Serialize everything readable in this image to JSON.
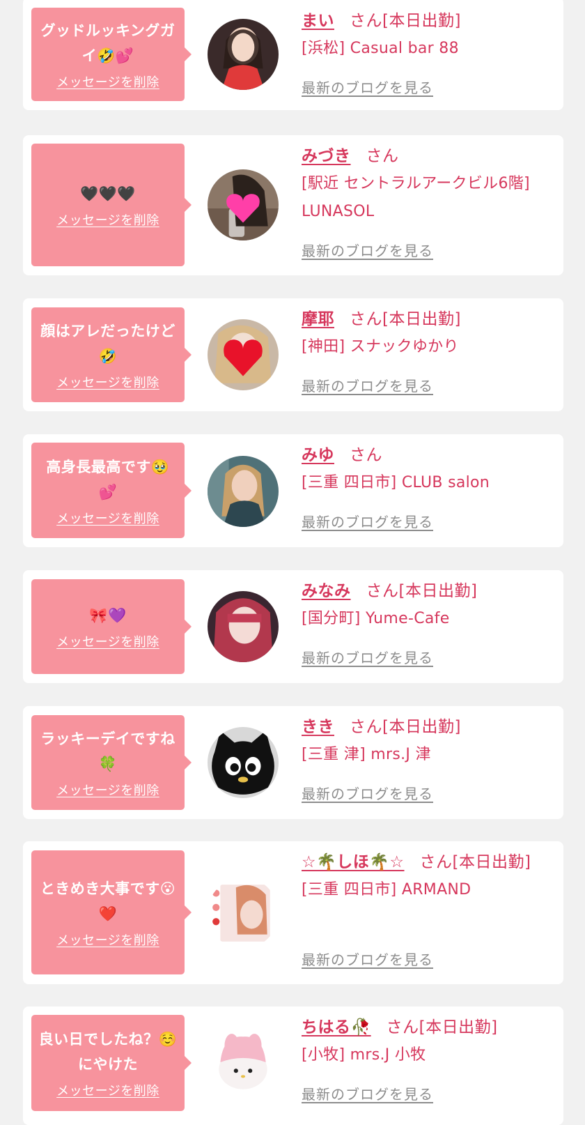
{
  "favorites": [
    {
      "message": "グッドルッキングガイ🤣💕",
      "delete_label": "メッセージを削除",
      "name": "まい",
      "suffix": "さん[本日出勤]",
      "store": "[浜松] Casual bar 88",
      "blog_label": "最新のブログを見る",
      "avatar_bg": "#3a2a2a",
      "avatar_fg": "#e03a3a"
    },
    {
      "message": "🖤🖤🖤",
      "delete_label": "メッセージを削除",
      "name": "みづき",
      "suffix": "さん",
      "store": "[駅近 セントラルアークビル6階] LUNASOL",
      "blog_label": "最新のブログを見る",
      "avatar_bg": "#8b7767",
      "avatar_fg": "#ff3fa8"
    },
    {
      "message": "顔はアレだったけど🤣",
      "delete_label": "メッセージを削除",
      "name": "摩耶",
      "suffix": "さん[本日出勤]",
      "store": "[神田] スナックゆかり",
      "blog_label": "最新のブログを見る",
      "avatar_bg": "#c9b8a6",
      "avatar_fg": "#e8122a"
    },
    {
      "message": "高身長最高です🥹💕",
      "delete_label": "メッセージを削除",
      "name": "みゆ",
      "suffix": "さん",
      "store": "[三重 四日市] CLUB salon",
      "blog_label": "最新のブログを見る",
      "avatar_bg": "#4f7178",
      "avatar_fg": "#d9a98a"
    },
    {
      "message": "🎀💜",
      "delete_label": "メッセージを削除",
      "name": "みなみ",
      "suffix": "さん[本日出勤]",
      "store": "[国分町] Yume-Cafe",
      "blog_label": "最新のブログを見る",
      "avatar_bg": "#3a2630",
      "avatar_fg": "#c46a7a"
    },
    {
      "message": "ラッキーデイですね🍀",
      "delete_label": "メッセージを削除",
      "name": "きき",
      "suffix": "さん[本日出勤]",
      "store": "[三重 津] mrs.J 津",
      "blog_label": "最新のブログを見る",
      "avatar_bg": "#d8d8d8",
      "avatar_fg": "#111111"
    },
    {
      "message": "ときめき大事です😮❤️",
      "delete_label": "メッセージを削除",
      "name": "☆🌴しほ🌴☆",
      "suffix": "さん[本日出勤]",
      "store": "[三重 四日市] ARMAND",
      "blog_label": "最新のブログを見る",
      "avatar_bg": "#f6e4e2",
      "avatar_fg": "#d98c6a"
    },
    {
      "message": "良い日でしたね？☺️にやけた",
      "delete_label": "メッセージを削除",
      "name": "ちはる🥀",
      "suffix": "さん[本日出勤]",
      "store": "[小牧] mrs.J 小牧",
      "blog_label": "最新のブログを見る",
      "avatar_bg": "#f7f2f2",
      "avatar_fg": "#f5b8c8"
    }
  ]
}
